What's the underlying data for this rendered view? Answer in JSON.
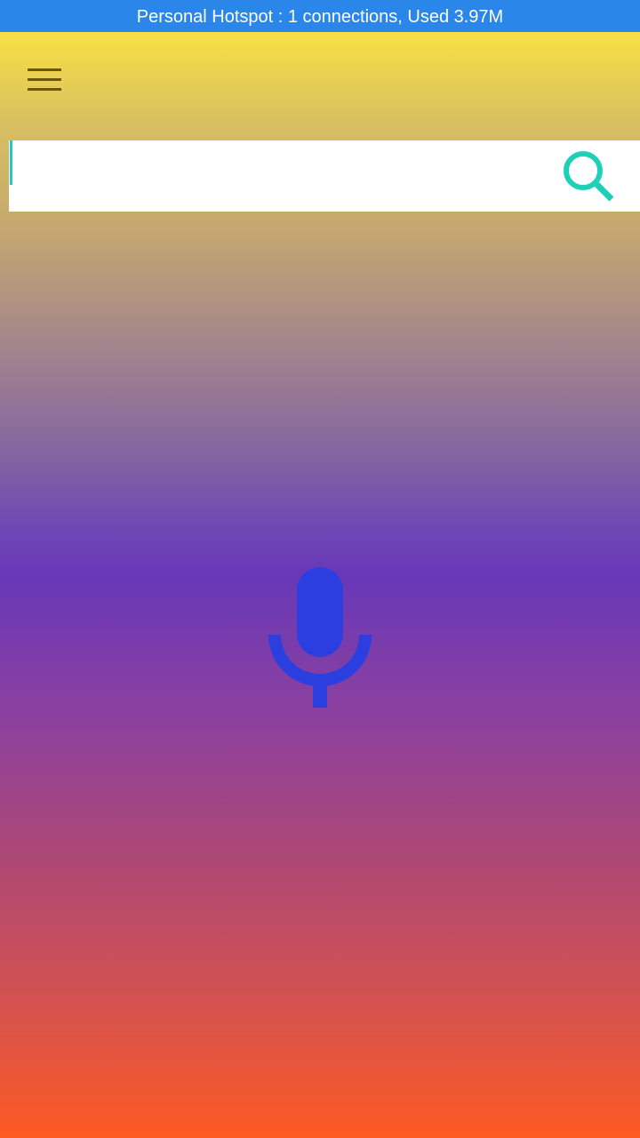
{
  "status_bar": {
    "text": "Personal Hotspot : 1 connections, Used 3.97M",
    "color": "#2a86e8"
  },
  "header": {
    "menu_icon": "hamburger-menu-icon"
  },
  "search": {
    "value": "",
    "placeholder": "",
    "icon": "search-icon",
    "icon_color": "#1fd0b8"
  },
  "main": {
    "mic_icon": "microphone-icon",
    "mic_color": "#2b3fe0"
  },
  "colors": {
    "gradient_top": "#f8e144",
    "gradient_middle": "#6838b8",
    "gradient_bottom": "#fd5a22"
  }
}
